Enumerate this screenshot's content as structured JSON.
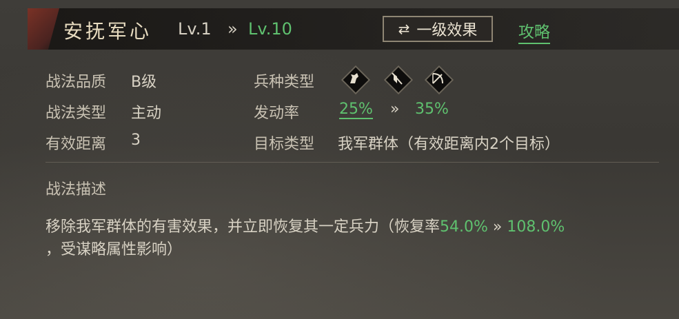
{
  "header": {
    "skill_name": "安抚军心",
    "level_from": "Lv.1",
    "level_arrow": "»",
    "level_to": "Lv.10",
    "effect_button_label": "一级效果",
    "guide_link": "攻略"
  },
  "stats": {
    "quality_label": "战法品质",
    "quality_value": "B级",
    "type_label": "战法类型",
    "type_value": "主动",
    "range_label": "有效距离",
    "range_value": "3",
    "troop_label": "兵种类型",
    "troop_icons": [
      "cavalry-icon",
      "shield-icon",
      "bow-icon"
    ],
    "rate_label": "发动率",
    "rate_from": "25%",
    "rate_arrow": "»",
    "rate_to": "35%",
    "target_label": "目标类型",
    "target_value": "我军群体（有效距离内2个目标）"
  },
  "description": {
    "title": "战法描述",
    "text_part1": "移除我军群体的有害效果，并立即恢复其一定兵力（恢复率",
    "value_from": "54.0%",
    "arrow": "»",
    "value_to": "108.0%",
    "text_part2": "，受谋略属性影响）"
  },
  "colors": {
    "highlight_green": "#5fc16f",
    "text": "#d8d2c4",
    "background": "#3a3835"
  }
}
